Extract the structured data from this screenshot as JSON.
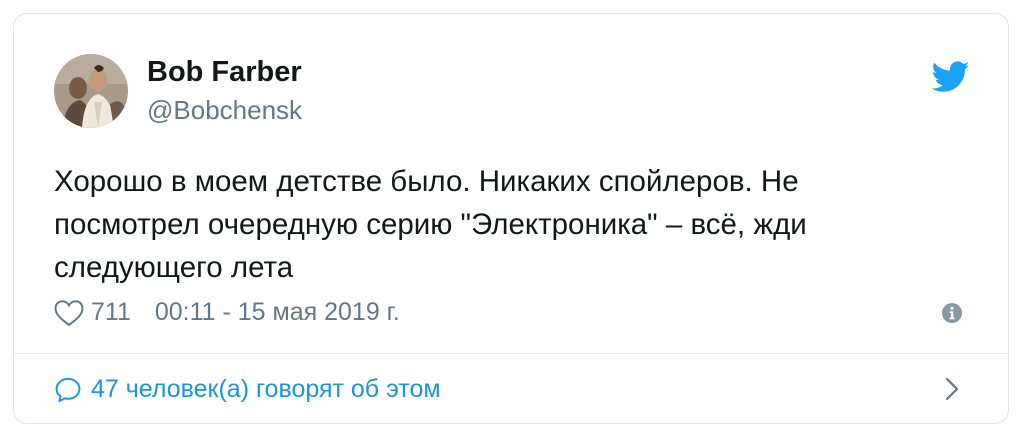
{
  "author": {
    "name": "Bob Farber",
    "handle": "@Bobchensk",
    "avatar_icon": "user-avatar"
  },
  "tweet": {
    "lines": [
      "Хорошо в моем детстве было. Никаких спойлеров. Не",
      "посмотрел очередную серию \"Электроника\" – всё, жди",
      "следующего лета"
    ]
  },
  "meta": {
    "like_count": "711",
    "timestamp": "00:11 - 15 мая 2019 г.",
    "icons": [
      "heart-icon",
      "info-icon"
    ]
  },
  "footer": {
    "conversation_label": "47 человек(а) говорят об этом",
    "icons": [
      "speech-bubble-icon",
      "chevron-right-icon"
    ]
  },
  "brand": {
    "icon": "twitter-bird-icon",
    "accent_color": "#1da1f2",
    "link_color": "#1b95e0"
  }
}
